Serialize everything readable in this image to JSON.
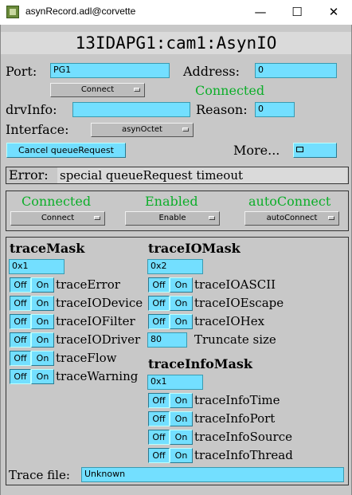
{
  "window": {
    "title": "asynRecord.adl@corvette",
    "minimize": "—",
    "maximize": "☐",
    "close": "✕"
  },
  "banner": "13IDAPG1:cam1:AsynIO",
  "port": {
    "label": "Port:",
    "value": "PG1"
  },
  "address": {
    "label": "Address:",
    "value": "0"
  },
  "connect_menu": "Connect",
  "connected_status": "Connected",
  "drvinfo": {
    "label": "drvInfo:",
    "value": ""
  },
  "reason": {
    "label": "Reason:",
    "value": "0"
  },
  "interface": {
    "label": "Interface:",
    "value": "asynOctet"
  },
  "cancel_button": "Cancel queueRequest",
  "more": {
    "label": "More...",
    "icon": "related-display-icon"
  },
  "error": {
    "label": "Error:",
    "value": "special queueRequest timeout"
  },
  "status_row": [
    {
      "status": "Connected",
      "menu": "Connect"
    },
    {
      "status": "Enabled",
      "menu": "Enable"
    },
    {
      "status": "autoConnect",
      "menu": "autoConnect"
    }
  ],
  "toggle": {
    "off": "Off",
    "on": "On"
  },
  "trace_mask": {
    "header": "traceMask",
    "value": "0x1",
    "items": [
      "traceError",
      "traceIODevice",
      "traceIOFilter",
      "traceIODriver",
      "traceFlow",
      "traceWarning"
    ]
  },
  "trace_io_mask": {
    "header": "traceIOMask",
    "value": "0x2",
    "items": [
      "traceIOASCII",
      "traceIOEscape",
      "traceIOHex"
    ],
    "truncate_value": "80",
    "truncate_label": "Truncate size"
  },
  "trace_info_mask": {
    "header": "traceInfoMask",
    "value": "0x1",
    "items": [
      "traceInfoTime",
      "traceInfoPort",
      "traceInfoSource",
      "traceInfoThread"
    ]
  },
  "trace_file": {
    "label": "Trace file:",
    "value": "Unknown"
  },
  "colors": {
    "field": "#73dfff",
    "background": "#c8c8c8",
    "status_green": "#0dae2a"
  }
}
